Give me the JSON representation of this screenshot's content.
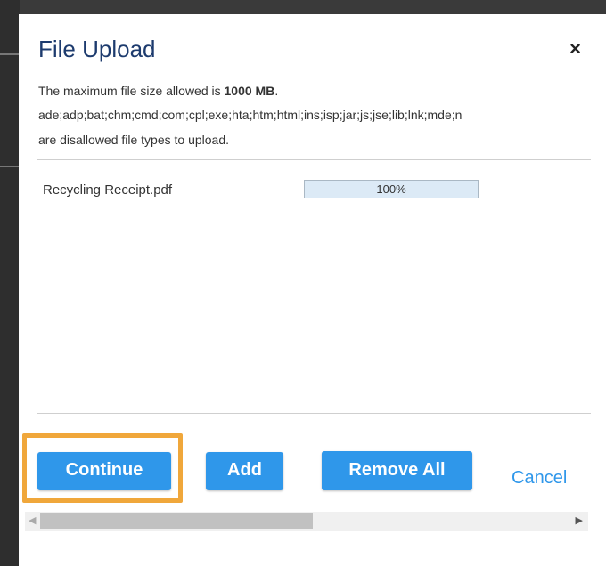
{
  "dialog": {
    "title": "File Upload",
    "close_label": "×",
    "info_prefix": "The maximum file size allowed is ",
    "max_size": "1000 MB",
    "info_suffix": ".",
    "disallowed_types": "ade;adp;bat;chm;cmd;com;cpl;exe;hta;htm;html;ins;isp;jar;js;jse;lib;lnk;mde;n",
    "disallowed_note": "are disallowed file types to upload."
  },
  "files": [
    {
      "name": "Recycling Receipt.pdf",
      "progress": 100,
      "progress_text": "100%"
    }
  ],
  "buttons": {
    "continue": "Continue",
    "add": "Add",
    "remove_all": "Remove All",
    "cancel": "Cancel"
  },
  "scrollbar": {
    "left_arrow": "◀",
    "right_arrow": "▶"
  },
  "colors": {
    "title": "#1d3b6e",
    "accent": "#2f97ea",
    "highlight": "#f0a73b"
  }
}
